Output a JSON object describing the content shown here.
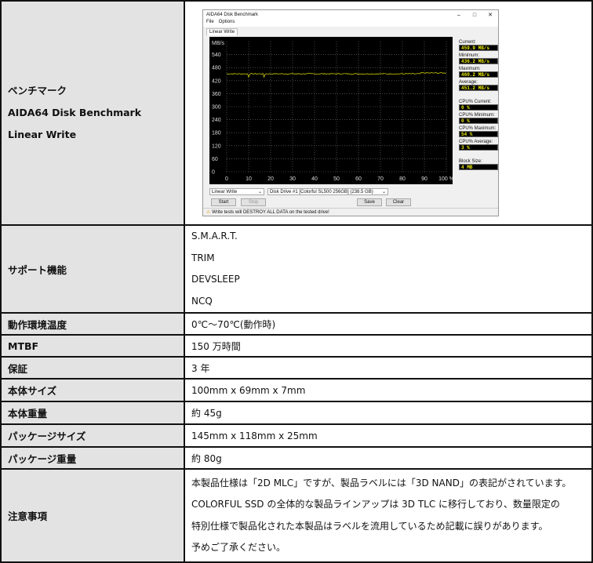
{
  "rows": [
    {
      "key": "ベンチマーク",
      "key2": "AIDA64 Disk Benchmark",
      "key3": "Linear Write"
    },
    {
      "key": "サポート機能",
      "values": [
        "S.M.A.R.T.",
        "TRIM",
        "DEVSLEEP",
        "NCQ"
      ]
    },
    {
      "key": "動作環境温度",
      "value": "0℃～70℃(動作時)"
    },
    {
      "key": "MTBF",
      "value": "150 万時間"
    },
    {
      "key": "保証",
      "value": "3 年"
    },
    {
      "key": "本体サイズ",
      "value": "100mm x 69mm x 7mm"
    },
    {
      "key": "本体重量",
      "value": "約 45g"
    },
    {
      "key": "パッケージサイズ",
      "value": "145mm x 118mm x 25mm"
    },
    {
      "key": "パッケージ重量",
      "value": "約 80g"
    },
    {
      "key": "注意事項",
      "values": [
        "本製品仕様は「2D MLC」ですが、製品ラベルには「3D NAND」の表記がされています。",
        "COLORFUL SSD の全体的な製品ラインアップは 3D TLC に移行しており、数量限定の",
        "特別仕様で製品化された本製品はラベルを流用しているため記載に誤りがあります。",
        "予めご了承ください。"
      ]
    }
  ],
  "app": {
    "title": "AIDA64 Disk Benchmark",
    "menu": [
      "File",
      "Options"
    ],
    "tab": "Linear Write",
    "stats": [
      {
        "label": "Current:",
        "value": "459.9 MB/s"
      },
      {
        "label": "Minimum:",
        "value": "436.2 MB/s"
      },
      {
        "label": "Maximum:",
        "value": "460.2 MB/s"
      },
      {
        "label": "Average:",
        "value": "451.2 MB/s"
      },
      {
        "label": "CPU% Current:",
        "value": "0 %"
      },
      {
        "label": "CPU% Minimum:",
        "value": "0 %"
      },
      {
        "label": "CPU% Maximum:",
        "value": "54 %"
      },
      {
        "label": "CPU% Average:",
        "value": "3 %"
      },
      {
        "label": "Block Size:",
        "value": "4 MB"
      }
    ],
    "test_select": "Linear Write",
    "drive_select": "Disk Drive #1  [Colorful SL500 256GB]  (238.5 GB)",
    "start": "Start",
    "stop": "Stop",
    "save": "Save",
    "clear": "Clear",
    "status": "Write tests will DESTROY ALL DATA on the tested drive!",
    "colors": {
      "line": "#c8c800",
      "grid": "#777777"
    }
  },
  "chart_data": {
    "type": "line",
    "ylabel": "MB/s",
    "yticks": [
      "540",
      "480",
      "420",
      "360",
      "300",
      "240",
      "180",
      "120",
      "60",
      "0"
    ],
    "xticks": [
      "0",
      "10",
      "20",
      "30",
      "40",
      "50",
      "60",
      "70",
      "80",
      "90",
      "100 %"
    ],
    "ylim": [
      0,
      600
    ],
    "xlim": [
      0,
      100
    ],
    "typical": 451.2,
    "min": 436.2,
    "max": 460.2,
    "dips_at": [
      10,
      17
    ]
  }
}
